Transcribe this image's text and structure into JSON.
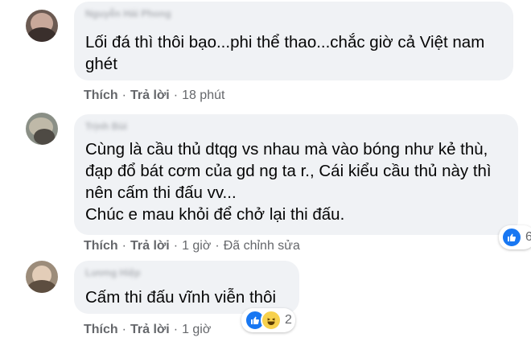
{
  "comments": [
    {
      "author": "Nguyễn Hải Phong",
      "text": "Lối đá thì thôi bạo...phi thể thao...chắc giờ cả Việt nam\nghét",
      "like_label": "Thích",
      "reply_label": "Trả lời",
      "time": "18 phút"
    },
    {
      "author": "Trịnh Bùi",
      "text": "Cùng là cầu thủ dtqg vs nhau mà vào bóng như kẻ thù,\nđạp đổ bát cơm của gd ng ta r., Cái kiểu cầu thủ này thì\nnên cấm thi đấu vv...\nChúc e mau khỏi để chở lại thi đấu.",
      "like_label": "Thích",
      "reply_label": "Trả lời",
      "time": "1 giờ",
      "edited": "Đã chỉnh sửa",
      "reaction_count": "6"
    },
    {
      "author": "Lương Hiệp",
      "text": "Cấm thi đấu vĩnh viễn thôi",
      "like_label": "Thích",
      "reply_label": "Trả lời",
      "time": "1 giờ",
      "reaction_count": "2"
    }
  ],
  "separator": "·",
  "colors": {
    "bubble": "#f0f2f5",
    "meta": "#65676b",
    "like_blue": "#1877f2",
    "haha_yellow": "#f7d14d"
  }
}
